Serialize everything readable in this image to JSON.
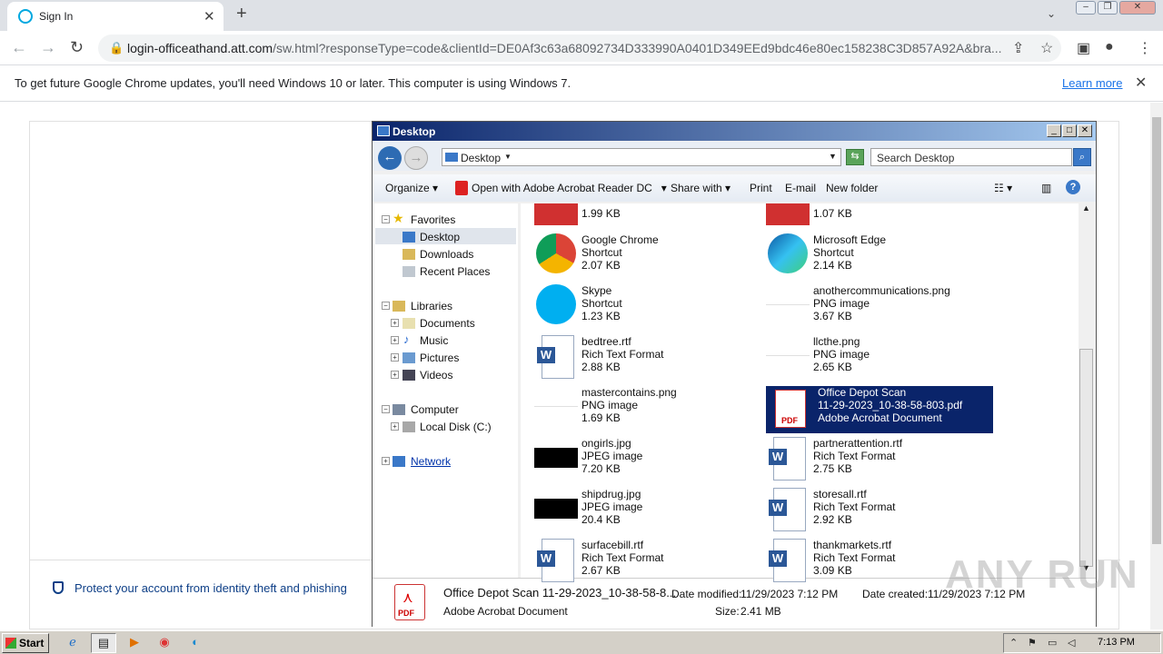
{
  "browser": {
    "tab_title": "Sign In",
    "url_host": "login-officeathand.att.com",
    "url_path": "/sw.html?responseType=code&clientId=DE0Af3c63a68092734D333990A0401D349EEd9bdc46e80ec158238C3D857A92A&bra..."
  },
  "infobar": {
    "message": "To get future Google Chrome updates, you'll need Windows 10 or later. This computer is using Windows 7.",
    "learn_more": "Learn more"
  },
  "page": {
    "protect_text": "Protect your account from identity theft and phishing"
  },
  "explorer": {
    "title": "Desktop",
    "address": "Desktop",
    "search_placeholder": "Search Desktop",
    "commands": {
      "organize": "Organize",
      "open_with": "Open with Adobe Acrobat Reader DC",
      "share": "Share with",
      "print": "Print",
      "email": "E-mail",
      "new_folder": "New folder"
    },
    "tree": {
      "favorites": "Favorites",
      "desktop": "Desktop",
      "downloads": "Downloads",
      "recent": "Recent Places",
      "libraries": "Libraries",
      "documents": "Documents",
      "music": "Music",
      "pictures": "Pictures",
      "videos": "Videos",
      "computer": "Computer",
      "local_disk": "Local Disk (C:)",
      "network": "Network"
    },
    "files": [
      {
        "name": "",
        "type": "",
        "size": "1.99 KB",
        "icon": "shortcut-icon"
      },
      {
        "name": "",
        "type": "",
        "size": "1.07 KB",
        "icon": "shortcut-icon"
      },
      {
        "name": "Google Chrome",
        "type": "Shortcut",
        "size": "2.07 KB",
        "icon": "chrome-icon"
      },
      {
        "name": "Microsoft Edge",
        "type": "Shortcut",
        "size": "2.14 KB",
        "icon": "edge-icon"
      },
      {
        "name": "Skype",
        "type": "Shortcut",
        "size": "1.23 KB",
        "icon": "skype-icon"
      },
      {
        "name": "anothercommunications.png",
        "type": "PNG image",
        "size": "3.67 KB",
        "icon": "png-icon"
      },
      {
        "name": "bedtree.rtf",
        "type": "Rich Text Format",
        "size": "2.88 KB",
        "icon": "word-icon"
      },
      {
        "name": "llcthe.png",
        "type": "PNG image",
        "size": "2.65 KB",
        "icon": "png-icon"
      },
      {
        "name": "mastercontains.png",
        "type": "PNG image",
        "size": "1.69 KB",
        "icon": "png-icon"
      },
      {
        "name": "Office Depot Scan",
        "name2": "11-29-2023_10-38-58-803.pdf",
        "type": "Adobe Acrobat Document",
        "icon": "pdf-icon"
      },
      {
        "name": "ongirls.jpg",
        "type": "JPEG image",
        "size": "7.20 KB",
        "icon": "jpg-icon"
      },
      {
        "name": "partnerattention.rtf",
        "type": "Rich Text Format",
        "size": "2.75 KB",
        "icon": "word-icon"
      },
      {
        "name": "shipdrug.jpg",
        "type": "JPEG image",
        "size": "20.4 KB",
        "icon": "jpg-icon"
      },
      {
        "name": "storesall.rtf",
        "type": "Rich Text Format",
        "size": "2.92 KB",
        "icon": "word-icon"
      },
      {
        "name": "surfacebill.rtf",
        "type": "Rich Text Format",
        "size": "2.67 KB",
        "icon": "word-icon"
      },
      {
        "name": "thankmarkets.rtf",
        "type": "Rich Text Format",
        "size": "3.09 KB",
        "icon": "word-icon"
      }
    ],
    "details": {
      "name": "Office Depot Scan 11-29-2023_10-38-58-8...",
      "type": "Adobe Acrobat Document",
      "modified_label": "Date modified:",
      "modified": "11/29/2023 7:12 PM",
      "size_label": "Size:",
      "size": "2.41 MB",
      "created_label": "Date created:",
      "created": "11/29/2023 7:12 PM"
    }
  },
  "taskbar": {
    "start": "Start",
    "clock": "7:13 PM"
  },
  "watermark": "ANY RUN"
}
